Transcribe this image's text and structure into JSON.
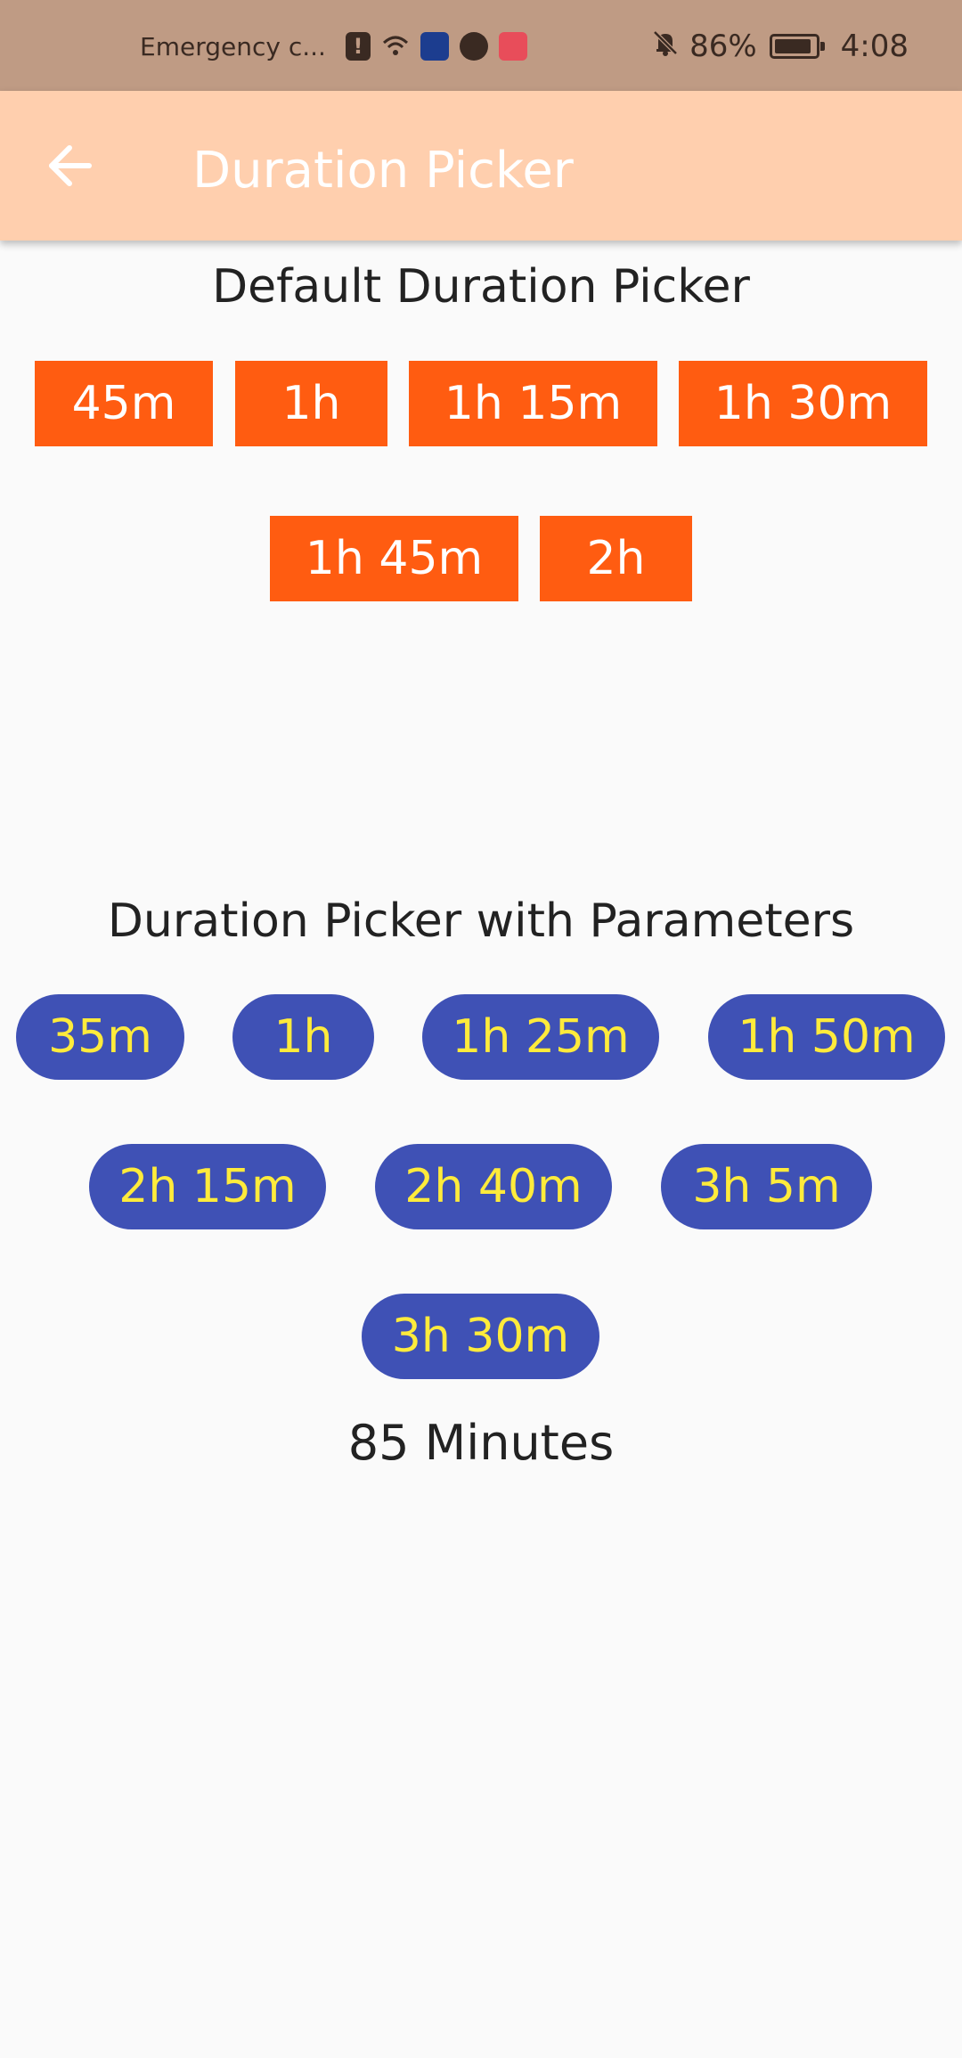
{
  "status_bar": {
    "carrier": "Emergency c...",
    "battery_percent": "86%",
    "time": "4:08"
  },
  "app_bar": {
    "title": "Duration Picker",
    "back_icon": "arrow-left-icon"
  },
  "default_picker": {
    "title": "Default Duration Picker",
    "color": "#ff5c11",
    "text_color": "#ffffff",
    "options": [
      "45m",
      "1h",
      "1h 15m",
      "1h 30m",
      "1h 45m",
      "2h"
    ]
  },
  "param_picker": {
    "title": "Duration Picker with Parameters",
    "color": "#3f51b5",
    "text_color": "#ffeb3b",
    "options": [
      "35m",
      "1h",
      "1h 25m",
      "1h 50m",
      "2h 15m",
      "2h 40m",
      "3h 5m",
      "3h 30m"
    ]
  },
  "result": {
    "text": "85 Minutes"
  },
  "colors": {
    "status_bar": "#bf9b84",
    "app_bar": "#ffcfae",
    "background": "#fafafa"
  }
}
